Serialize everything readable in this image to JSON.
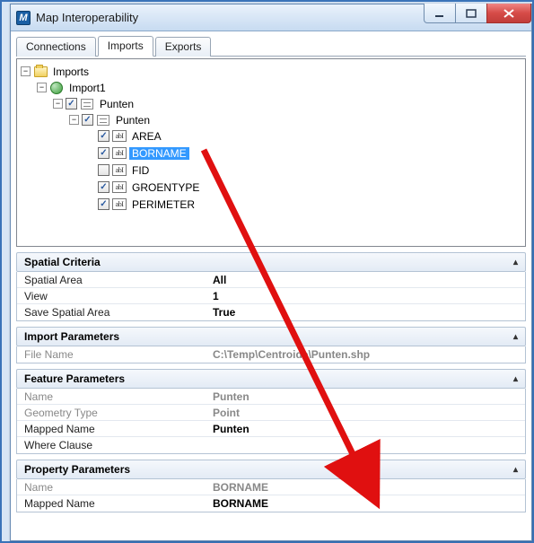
{
  "window": {
    "title": "Map Interoperability"
  },
  "tabs": {
    "connections": "Connections",
    "imports": "Imports",
    "exports": "Exports"
  },
  "tree": {
    "root": "Imports",
    "import1": "Import1",
    "punten_src": "Punten",
    "punten_fc": "Punten",
    "fields": {
      "area": "AREA",
      "borname": "BORNAME",
      "fid": "FID",
      "groentype": "GROENTYPE",
      "perimeter": "PERIMETER"
    }
  },
  "toggle_minus": "−",
  "abi_text": "abI",
  "spatial": {
    "header": "Spatial Criteria",
    "area_label": "Spatial Area",
    "area_value": "All",
    "view_label": "View",
    "view_value": "1",
    "save_label": "Save Spatial Area",
    "save_value": "True"
  },
  "import_params": {
    "header": "Import Parameters",
    "file_label": "File Name",
    "file_value": "C:\\Temp\\Centroide\\Punten.shp"
  },
  "feature_params": {
    "header": "Feature Parameters",
    "name_label": "Name",
    "name_value": "Punten",
    "geom_label": "Geometry Type",
    "geom_value": "Point",
    "mapped_label": "Mapped Name",
    "mapped_value": "Punten",
    "where_label": "Where Clause",
    "where_value": ""
  },
  "property_params": {
    "header": "Property Parameters",
    "name_label": "Name",
    "name_value": "BORNAME",
    "mapped_label": "Mapped Name",
    "mapped_value": "BORNAME"
  }
}
